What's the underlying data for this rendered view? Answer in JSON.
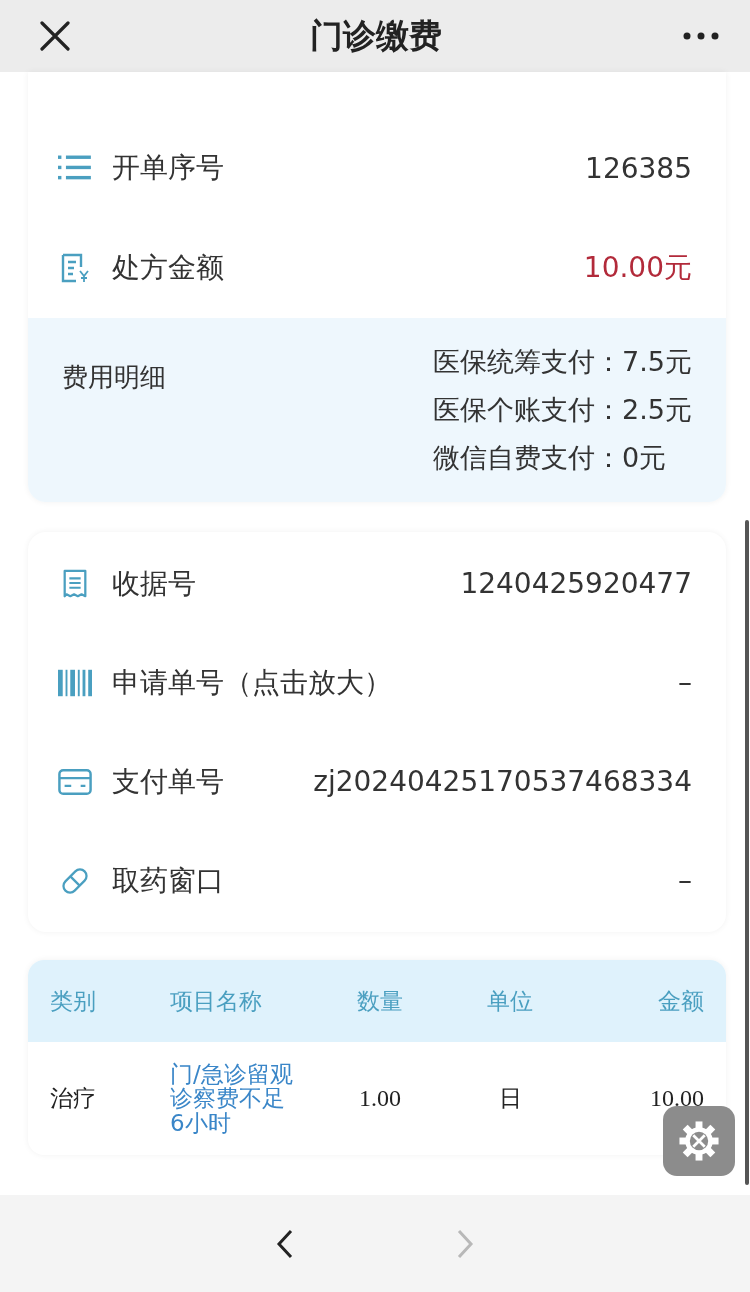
{
  "nav": {
    "title": "门诊缴费"
  },
  "order_card": {
    "rows": [
      {
        "kind": "list",
        "label": "开单序号",
        "value": "126385",
        "emphasis": false
      },
      {
        "kind": "bill",
        "label": "处方金额",
        "value": "10.00元",
        "emphasis": true
      }
    ],
    "fee_detail": {
      "label": "费用明细",
      "lines": [
        "医保统筹支付：7.5元",
        "医保个账支付：2.5元",
        "微信自费支付：0元"
      ]
    }
  },
  "receipt_card": {
    "rows": [
      {
        "kind": "receipt",
        "label": "收据号",
        "value": "1240425920477"
      },
      {
        "kind": "barcode",
        "label": "申请单号（点击放大）",
        "value": "–"
      },
      {
        "kind": "card",
        "label": "支付单号",
        "value": "zj20240425170537468334"
      },
      {
        "kind": "pill",
        "label": "取药窗口",
        "value": "–"
      }
    ]
  },
  "table": {
    "columns": [
      "类别",
      "项目名称",
      "数量",
      "单位",
      "金额"
    ],
    "rows": [
      [
        "治疗",
        "门/急诊留观诊察费不足6小时",
        "1.00",
        "日",
        "10.00"
      ]
    ]
  },
  "bottom_bar": {
    "back": {
      "disabled": false
    },
    "forward": {
      "disabled": true
    }
  }
}
